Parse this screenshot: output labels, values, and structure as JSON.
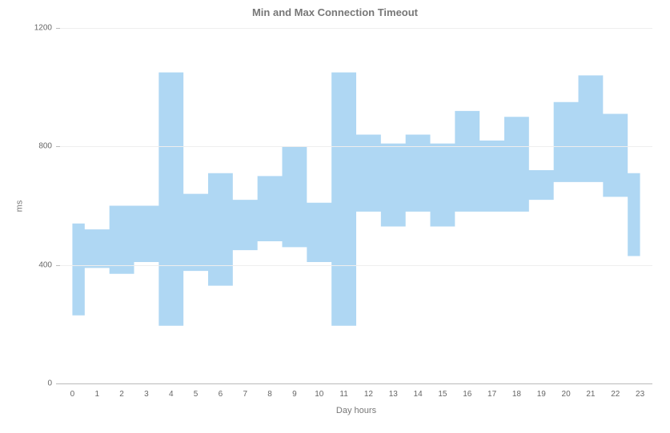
{
  "chart_data": {
    "type": "area",
    "subtype": "range-step",
    "title": "Min and Max Connection Timeout",
    "xlabel": "Day hours",
    "ylabel": "ms",
    "categories": [
      "0",
      "1",
      "2",
      "3",
      "4",
      "5",
      "6",
      "7",
      "8",
      "9",
      "10",
      "11",
      "12",
      "13",
      "14",
      "15",
      "16",
      "17",
      "18",
      "19",
      "20",
      "21",
      "22",
      "23"
    ],
    "y_ticks": [
      0,
      400,
      800,
      1200
    ],
    "ylim": [
      0,
      1200
    ],
    "series": [
      {
        "name": "Min",
        "values": [
          230,
          390,
          370,
          410,
          195,
          380,
          330,
          450,
          480,
          460,
          410,
          195,
          580,
          530,
          580,
          530,
          580,
          580,
          580,
          620,
          680,
          680,
          630,
          430
        ]
      },
      {
        "name": "Max",
        "values": [
          540,
          520,
          600,
          600,
          1050,
          640,
          710,
          620,
          700,
          800,
          610,
          1050,
          840,
          810,
          840,
          810,
          920,
          820,
          900,
          720,
          950,
          1040,
          910,
          710
        ]
      }
    ]
  },
  "style": {
    "fill_color": "#a6d3f2"
  }
}
